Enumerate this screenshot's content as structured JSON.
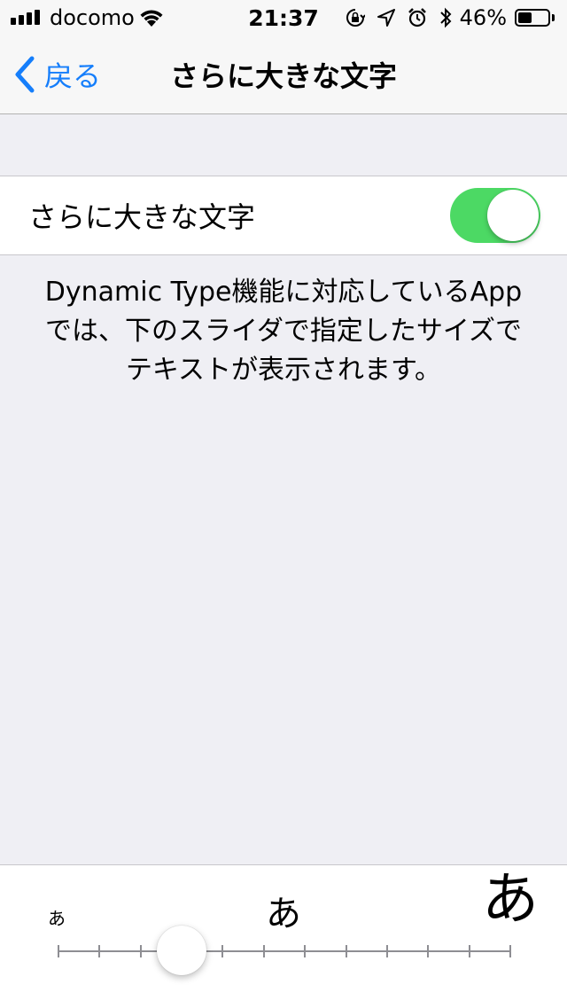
{
  "status_bar": {
    "carrier": "docomo",
    "time": "21:37",
    "battery_percent": "46%",
    "battery_level": 0.46,
    "icons": [
      "signal-icon",
      "wifi-icon",
      "rotation-lock-icon",
      "location-icon",
      "alarm-icon",
      "bluetooth-icon",
      "battery-icon"
    ]
  },
  "nav": {
    "back_label": "戻る",
    "title": "さらに大きな文字"
  },
  "setting": {
    "label": "さらに大きな文字",
    "toggle_on": true
  },
  "description": "Dynamic Type機能に対応しているAppでは、下のスライダで指定したサイズでテキストが表示されます。",
  "slider": {
    "small_label": "あ",
    "mid_label": "あ",
    "large_label": "あ",
    "steps": 12,
    "selected_step": 3
  },
  "colors": {
    "accent": "#157efb",
    "toggle_on": "#4cd964",
    "background": "#efeff4"
  }
}
